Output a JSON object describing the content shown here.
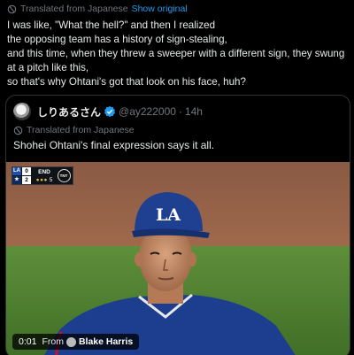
{
  "post": {
    "translated_label": "Translated from Japanese",
    "show_original_label": "Show original",
    "text_lines": [
      "I was like, \"What the hell?\" and then I realized",
      "the opposing team has a history of sign-stealing,",
      "and this time, when they threw a sweeper with a different sign, they swung",
      "at a pitch like this,",
      "so that's why Ohtani's got that look on his face, huh?"
    ]
  },
  "quote": {
    "name": "しりあるさん",
    "handle": "@ay222000",
    "separator": "·",
    "time": "14h",
    "translated_label": "Translated from Japanese",
    "text": "Shohei Ohtani's final expression says it all."
  },
  "video": {
    "scorebug": {
      "team1_logo": "LA",
      "team1_score": "0",
      "team2_logo": "★",
      "team2_score": "2",
      "inning": "END",
      "outs_count": "5",
      "outs_dots": "●●●",
      "network": "TNT",
      "network_sub": "SPORTS"
    },
    "cap_logo": "LA",
    "timestamp": "0:01",
    "from_label": "From",
    "source_name": "Blake Harris"
  },
  "colors": {
    "accent": "#1d9bf0",
    "muted": "#71767b",
    "text": "#e7e9ea",
    "background": "#000000"
  },
  "icons": [
    "translate-globe-icon",
    "verified-badge-icon",
    "source-avatar"
  ]
}
